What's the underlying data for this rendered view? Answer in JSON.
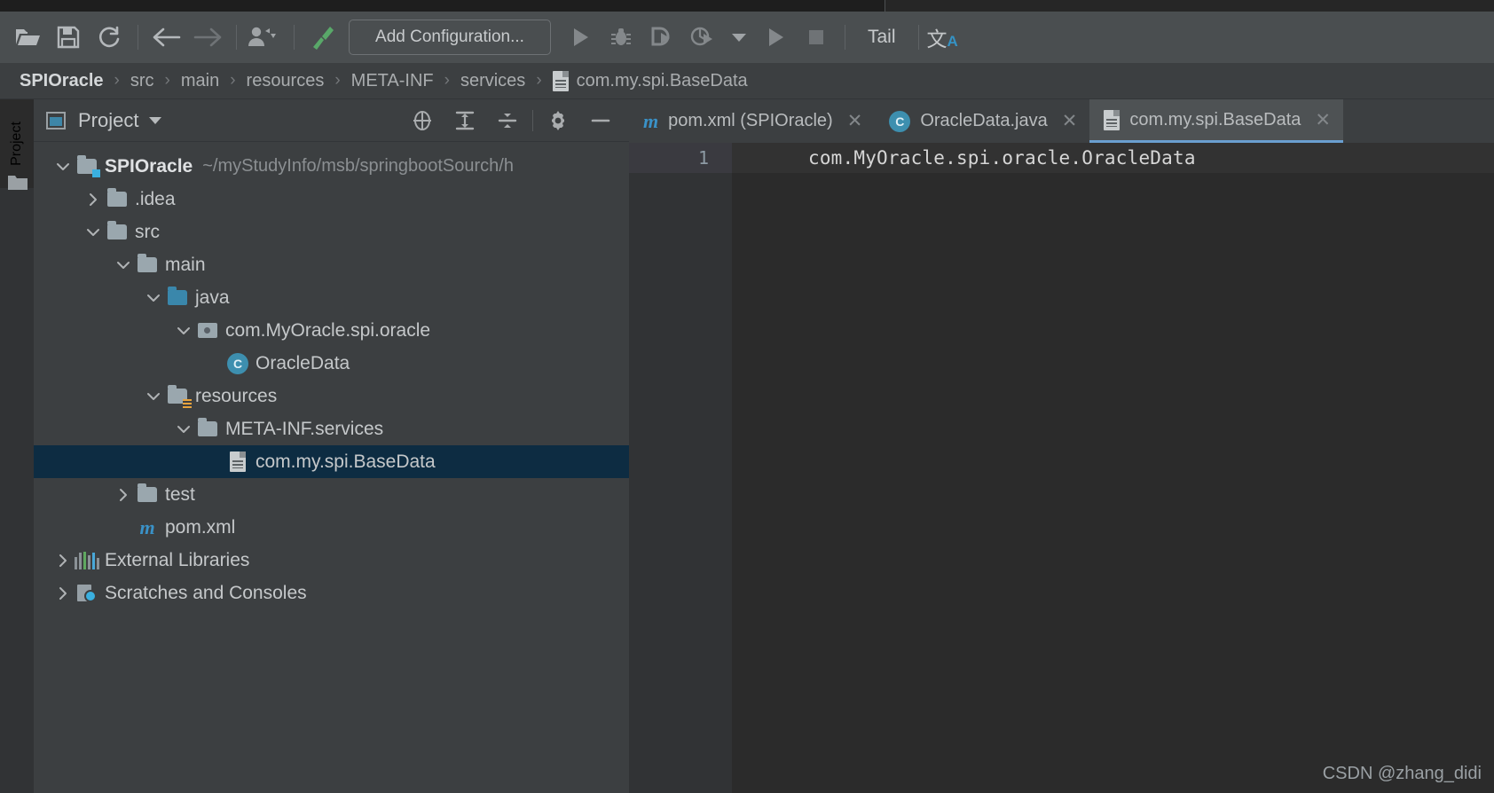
{
  "toolbar": {
    "buttons": [
      {
        "name": "open-folder-icon",
        "label": ""
      },
      {
        "name": "save-all-icon",
        "label": ""
      },
      {
        "name": "sync-refresh-icon",
        "label": ""
      },
      {
        "name": "back-arrow-icon",
        "label": ""
      },
      {
        "name": "forward-arrow-icon",
        "label": ""
      },
      {
        "name": "user-dropdown-icon",
        "label": ""
      },
      {
        "name": "build-hammer-icon",
        "label": ""
      }
    ],
    "add_configuration": "Add Configuration...",
    "run_icon": "run-icon",
    "debug_icon": "debug-icon",
    "run-coverage_icon": "run-with-coverage-icon",
    "profiler_icon": "profiler-icon",
    "profiler_dropdown_icon": "chevron-down-icon",
    "run2_icon": "run-icon",
    "stop_icon": "stop-icon",
    "tail_label": "Tail",
    "translate_cn": "文",
    "translate_a": "A"
  },
  "breadcrumb": {
    "items": [
      "SPIOracle",
      "src",
      "main",
      "resources",
      "META-INF",
      "services"
    ],
    "file": "com.my.spi.BaseData",
    "separator": "›"
  },
  "left_strip": {
    "vertical_tab": "Project"
  },
  "project_panel": {
    "title": "Project",
    "header_icons": [
      {
        "name": "locate-target-icon"
      },
      {
        "name": "expand-all-icon"
      },
      {
        "name": "collapse-all-icon"
      },
      {
        "name": "gear-settings-icon"
      },
      {
        "name": "hide-panel-icon"
      }
    ],
    "tree": [
      {
        "indent": 0,
        "twisty": "expanded",
        "icon": "module-folder-icon",
        "label": "SPIOracle",
        "bold": true,
        "path": "~/myStudyInfo/msb/springbootSourch/h",
        "selected": false
      },
      {
        "indent": 1,
        "twisty": "collapsed",
        "icon": "folder-icon",
        "label": ".idea",
        "bold": false,
        "path": "",
        "selected": false
      },
      {
        "indent": 1,
        "twisty": "expanded",
        "icon": "folder-icon",
        "label": "src",
        "bold": false,
        "path": "",
        "selected": false
      },
      {
        "indent": 2,
        "twisty": "expanded",
        "icon": "folder-icon",
        "label": "main",
        "bold": false,
        "path": "",
        "selected": false
      },
      {
        "indent": 3,
        "twisty": "expanded",
        "icon": "source-root-folder-icon",
        "label": "java",
        "bold": false,
        "path": "",
        "selected": false
      },
      {
        "indent": 4,
        "twisty": "expanded",
        "icon": "package-icon",
        "label": "com.MyOracle.spi.oracle",
        "bold": false,
        "path": "",
        "selected": false
      },
      {
        "indent": 5,
        "twisty": "none",
        "icon": "java-class-icon",
        "label": "OracleData",
        "bold": false,
        "path": "",
        "selected": false
      },
      {
        "indent": 3,
        "twisty": "expanded",
        "icon": "resource-root-folder-icon",
        "label": "resources",
        "bold": false,
        "path": "",
        "selected": false
      },
      {
        "indent": 4,
        "twisty": "expanded",
        "icon": "folder-icon",
        "label": "META-INF.services",
        "bold": false,
        "path": "",
        "selected": false
      },
      {
        "indent": 5,
        "twisty": "none",
        "icon": "text-file-icon",
        "label": "com.my.spi.BaseData",
        "bold": false,
        "path": "",
        "selected": true
      },
      {
        "indent": 2,
        "twisty": "collapsed",
        "icon": "folder-icon",
        "label": "test",
        "bold": false,
        "path": "",
        "selected": false
      },
      {
        "indent": 2,
        "twisty": "none",
        "icon": "maven-icon",
        "label": "pom.xml",
        "bold": false,
        "path": "",
        "selected": false
      },
      {
        "indent": 0,
        "twisty": "collapsed",
        "icon": "external-libraries-icon",
        "label": "External Libraries",
        "bold": false,
        "path": "",
        "selected": false
      },
      {
        "indent": 0,
        "twisty": "collapsed",
        "icon": "scratches-icon",
        "label": "Scratches and Consoles",
        "bold": false,
        "path": "",
        "selected": false
      }
    ]
  },
  "editor": {
    "tabs": [
      {
        "icon": "maven-icon",
        "label": "pom.xml (SPIOracle)",
        "closable": true,
        "active": false
      },
      {
        "icon": "java-class-icon",
        "label": "OracleData.java",
        "closable": true,
        "active": false
      },
      {
        "icon": "text-file-icon",
        "label": "com.my.spi.BaseData",
        "closable": true,
        "active": true
      }
    ],
    "close_glyph": "✕",
    "lines": [
      {
        "number": "1",
        "text": "com.MyOracle.spi.oracle.OracleData"
      }
    ]
  },
  "watermark": "CSDN @zhang_didi",
  "colors": {
    "toolbar_bg": "#4a4e50",
    "panel_bg": "#3c3f41",
    "editor_bg": "#2b2b2b",
    "selection_bg": "#0d2c42",
    "accent_blue": "#3a92c8",
    "source_root": "#3a87ab",
    "resource_orange": "#e8a33d",
    "tab_active_bg": "#4e5254",
    "tab_underline": "#6a9fd0"
  }
}
